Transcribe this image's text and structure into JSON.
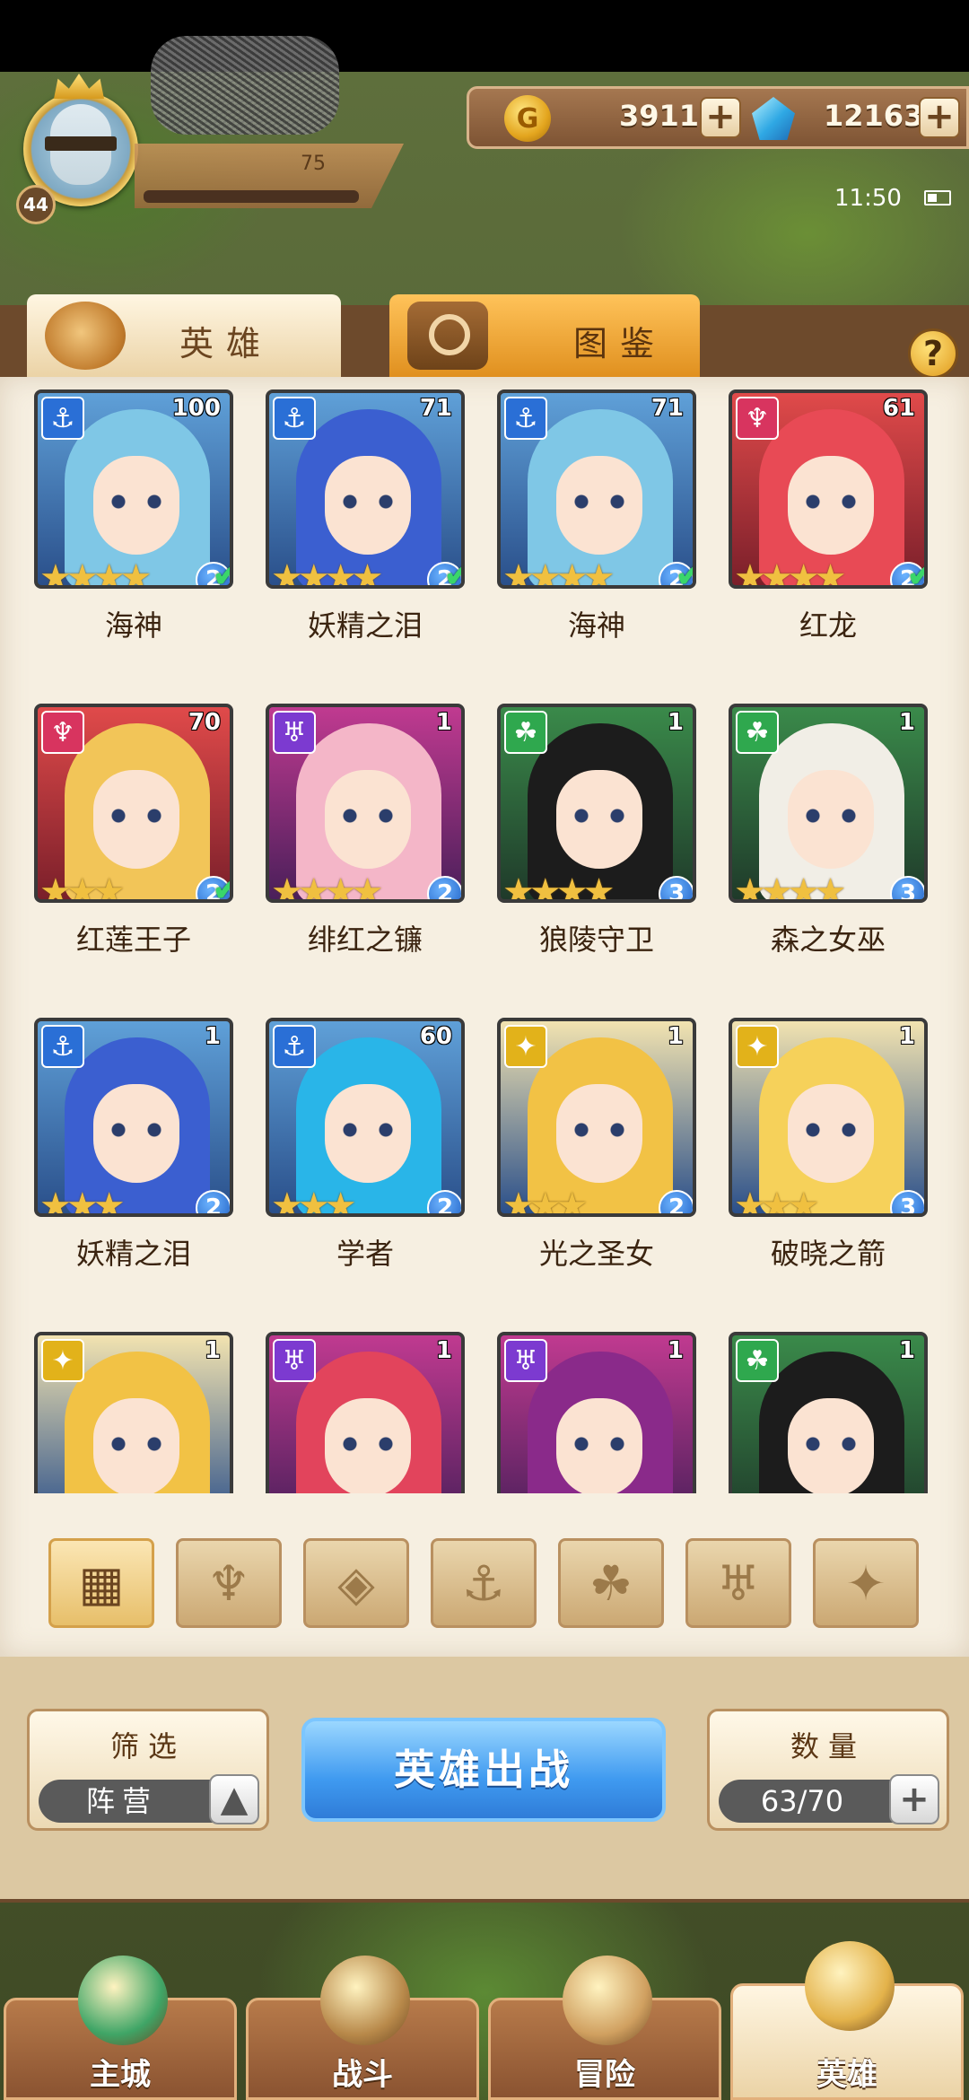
{
  "player": {
    "level": "44",
    "exp_text": "75"
  },
  "currency": {
    "gold": "3911",
    "gems": "12163",
    "plus": "+"
  },
  "status": {
    "time": "11:50"
  },
  "tabs": [
    {
      "label": "英雄",
      "active": true
    },
    {
      "label": "图鉴",
      "active": false
    }
  ],
  "help_label": "?",
  "heroes": [
    {
      "name": "海神",
      "level": "100",
      "stars": "★★★★",
      "faction": "⚓",
      "faction_color": "#2a6fd6",
      "tier": "2",
      "selected": true,
      "hair": "#7fc7e6"
    },
    {
      "name": "妖精之泪",
      "level": "71",
      "stars": "★★★★",
      "faction": "⚓",
      "faction_color": "#2a6fd6",
      "tier": "2",
      "selected": true,
      "hair": "#3b5fd0"
    },
    {
      "name": "海神",
      "level": "71",
      "stars": "★★★★",
      "faction": "⚓",
      "faction_color": "#2a6fd6",
      "tier": "2",
      "selected": true,
      "hair": "#7fc7e6"
    },
    {
      "name": "红龙",
      "level": "61",
      "stars": "★★★★",
      "faction": "♆",
      "faction_color": "#d8345f",
      "tier": "2",
      "selected": true,
      "hair": "#e84a55"
    },
    {
      "name": "红莲王子",
      "level": "70",
      "stars": "★★★",
      "faction": "♆",
      "faction_color": "#d8345f",
      "tier": "2",
      "selected": true,
      "hair": "#f2c558"
    },
    {
      "name": "绯红之镰",
      "level": "1",
      "stars": "★★★★",
      "faction": "♅",
      "faction_color": "#7c3ad0",
      "tier": "2",
      "selected": false,
      "hair": "#f4b6c8"
    },
    {
      "name": "狼陵守卫",
      "level": "1",
      "stars": "★★★★",
      "faction": "☘",
      "faction_color": "#2fa84e",
      "tier": "3",
      "selected": false,
      "hair": "#1c1c1c"
    },
    {
      "name": "森之女巫",
      "level": "1",
      "stars": "★★★★",
      "faction": "☘",
      "faction_color": "#2fa84e",
      "tier": "3",
      "selected": false,
      "hair": "#f1eee6"
    },
    {
      "name": "妖精之泪",
      "level": "1",
      "stars": "★★★",
      "faction": "⚓",
      "faction_color": "#2a6fd6",
      "tier": "2",
      "selected": false,
      "hair": "#3b5fd0"
    },
    {
      "name": "学者",
      "level": "60",
      "stars": "★★★",
      "faction": "⚓",
      "faction_color": "#2a6fd6",
      "tier": "2",
      "selected": false,
      "hair": "#29b5e8"
    },
    {
      "name": "光之圣女",
      "level": "1",
      "stars": "★★★",
      "faction": "✦",
      "faction_color": "#e2b21a",
      "tier": "2",
      "selected": false,
      "hair": "#f2c245"
    },
    {
      "name": "破晓之箭",
      "level": "1",
      "stars": "★★★",
      "faction": "✦",
      "faction_color": "#e2b21a",
      "tier": "3",
      "selected": false,
      "hair": "#f6d15a"
    },
    {
      "name": "",
      "level": "1",
      "stars": "",
      "faction": "✦",
      "faction_color": "#e2b21a",
      "tier": "",
      "selected": false,
      "hair": "#f2c245"
    },
    {
      "name": "",
      "level": "1",
      "stars": "",
      "faction": "♅",
      "faction_color": "#7c3ad0",
      "tier": "",
      "selected": false,
      "hair": "#e2445c"
    },
    {
      "name": "",
      "level": "1",
      "stars": "",
      "faction": "♅",
      "faction_color": "#7c3ad0",
      "tier": "",
      "selected": false,
      "hair": "#8a2a8a"
    },
    {
      "name": "",
      "level": "1",
      "stars": "",
      "faction": "☘",
      "faction_color": "#2fa84e",
      "tier": "",
      "selected": false,
      "hair": "#1c1c1c"
    }
  ],
  "filters": [
    {
      "icon": "grid-icon",
      "glyph": "▦",
      "active": true
    },
    {
      "icon": "fire-faction-icon",
      "glyph": "♆",
      "active": false
    },
    {
      "icon": "diamond-faction-icon",
      "glyph": "◈",
      "active": false
    },
    {
      "icon": "anchor-faction-icon",
      "glyph": "⚓",
      "active": false
    },
    {
      "icon": "beast-faction-icon",
      "glyph": "☘",
      "active": false
    },
    {
      "icon": "dark-faction-icon",
      "glyph": "♅",
      "active": false
    },
    {
      "icon": "light-faction-icon",
      "glyph": "✦",
      "active": false
    }
  ],
  "controls": {
    "filter_title": "筛选",
    "filter_value": "阵营",
    "deploy_label": "英雄出战",
    "count_title": "数量",
    "count_value": "63/70",
    "arrow_up": "▲"
  },
  "nav": [
    {
      "label": "主城",
      "icon": "castle-icon",
      "color": "#3fa566",
      "active": false
    },
    {
      "label": "战斗",
      "icon": "swords-icon",
      "color": "#b8894a",
      "active": false
    },
    {
      "label": "冒险",
      "icon": "map-scroll-icon",
      "color": "#d0a060",
      "active": false
    },
    {
      "label": "英雄",
      "icon": "hero-helmet-icon",
      "color": "#e3b24a",
      "active": true
    }
  ]
}
